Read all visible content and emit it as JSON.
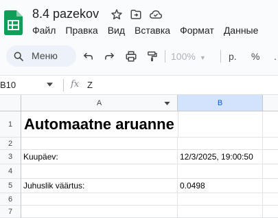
{
  "document": {
    "title": "8.4 pazekov"
  },
  "menu": [
    "Файл",
    "Правка",
    "Вид",
    "Вставка",
    "Формат",
    "Данные"
  ],
  "toolbar": {
    "search_label": "Меню",
    "zoom": "100%",
    "format_currency": "р.",
    "format_percent": "%",
    "format_more": "."
  },
  "formula_bar": {
    "cell_ref": "B10",
    "fx_label": "fx",
    "value": "Z"
  },
  "sheet": {
    "columns": [
      "A",
      "B"
    ],
    "selected_column": "B",
    "rows": [
      {
        "number": "1",
        "a": "Automaatne aruanne",
        "b": ""
      },
      {
        "number": "2",
        "a": "",
        "b": ""
      },
      {
        "number": "3",
        "a": "Kuupäev:",
        "b": "12/3/2025, 19:00:50"
      },
      {
        "number": "4",
        "a": "",
        "b": ""
      },
      {
        "number": "5",
        "a": "Juhuslik väärtus:",
        "b": "0.0498"
      },
      {
        "number": "6",
        "a": "",
        "b": ""
      },
      {
        "number": "7",
        "a": "",
        "b": ""
      }
    ]
  },
  "colors": {
    "app_background": "#f9fbfd",
    "accent_green": "#0f9d58",
    "selected_header": "#d3e3fd",
    "selected_header_text": "#0b57d0"
  },
  "icons": {
    "logo": "google-sheets-logo",
    "star": "star-icon",
    "move": "folder-move-icon",
    "cloud": "cloud-saved-icon",
    "search": "search-icon",
    "undo": "undo-icon",
    "redo": "redo-icon",
    "print": "print-icon",
    "paint_format": "paint-format-icon"
  }
}
